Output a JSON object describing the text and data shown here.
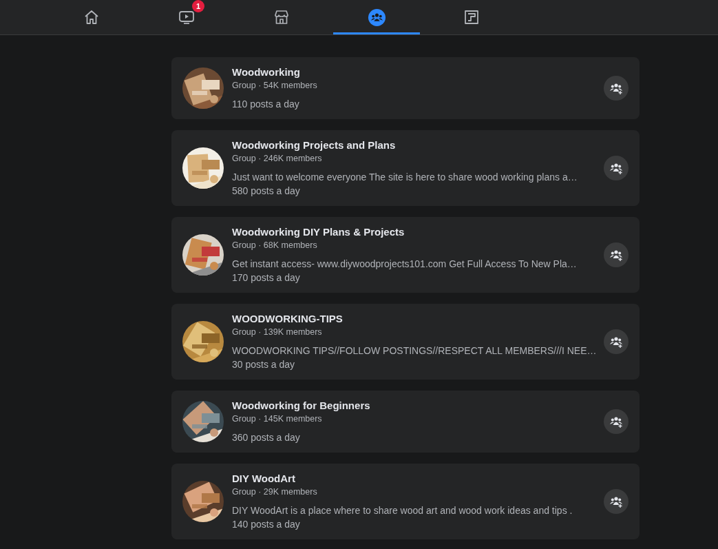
{
  "nav_tabs": [
    {
      "kind": "home",
      "selected": false
    },
    {
      "kind": "video",
      "selected": false,
      "badge": "1"
    },
    {
      "kind": "marketplace",
      "selected": false
    },
    {
      "kind": "groups",
      "selected": true
    },
    {
      "kind": "gaming",
      "selected": false
    }
  ],
  "groups": [
    {
      "name": "Woodworking",
      "meta": "Group · 54K members",
      "posts": "110 posts a day"
    },
    {
      "name": "Woodworking Projects and Plans",
      "meta": "Group · 246K members",
      "description": "Just want to welcome everyone The site is here to share wood working plans a…",
      "posts": "580 posts a day"
    },
    {
      "name": "Woodworking DIY Plans & Projects",
      "meta": "Group · 68K members",
      "description": "Get instant access- www.diywoodprojects101.com Get Full Access To New Pla…",
      "posts": "170 posts a day"
    },
    {
      "name": "WOODWORKING-TIPS",
      "meta": "Group · 139K members",
      "description": "WOODWORKING TIPS//FOLLOW POSTINGS//RESPECT ALL MEMBERS///I NEE…",
      "posts": "30 posts a day"
    },
    {
      "name": "Woodworking for Beginners",
      "meta": "Group · 145K members",
      "posts": "360 posts a day"
    },
    {
      "name": "DIY WoodArt",
      "meta": "Group · 29K members",
      "description": "DIY WoodArt is a place where to share wood art and wood work ideas and tips .",
      "posts": "140 posts a day"
    }
  ]
}
